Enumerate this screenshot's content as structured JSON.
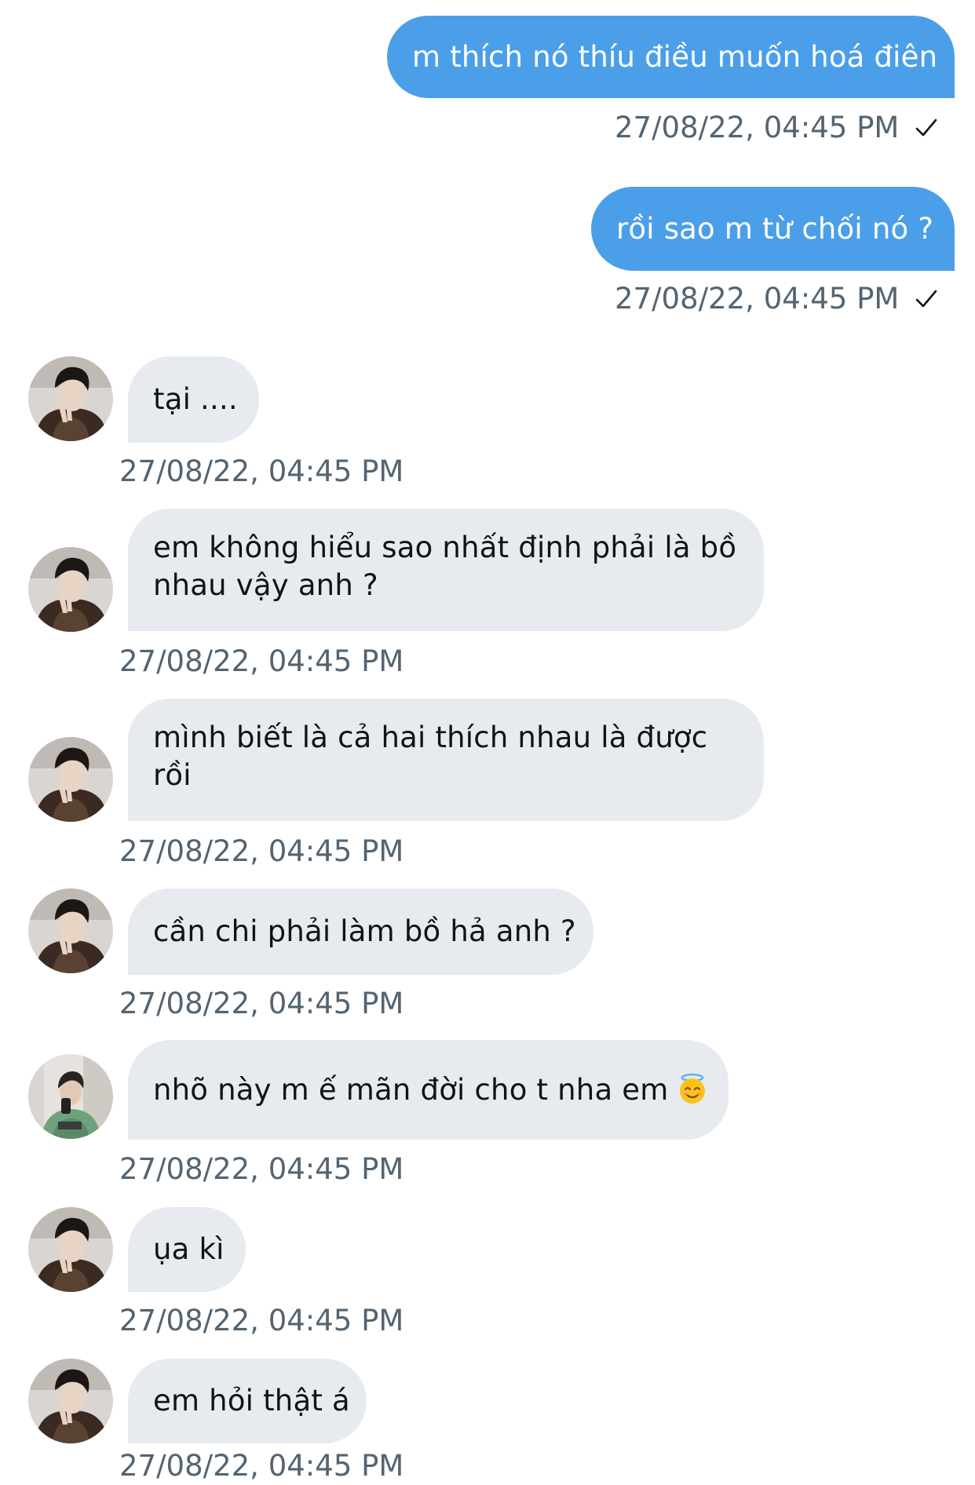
{
  "messages": [
    {
      "text": "m thích nó thíu điều muốn hoá điên",
      "time": "27/08/22, 04:45 PM"
    },
    {
      "text": "rồi sao m từ chối nó ?",
      "time": "27/08/22, 04:45 PM"
    },
    {
      "text": "tại ....",
      "time": "27/08/22, 04:45 PM"
    },
    {
      "text": "em không hiểu sao nhất định phải là bồ nhau vậy anh ?",
      "time": "27/08/22, 04:45 PM"
    },
    {
      "text": "mình biết là cả hai thích nhau là được rồi",
      "time": "27/08/22, 04:45 PM"
    },
    {
      "text": "cần chi phải làm bồ hả anh ?",
      "time": "27/08/22, 04:45 PM"
    },
    {
      "text": "nhõ này m ế mãn đời cho t nha em",
      "time": "27/08/22, 04:45 PM",
      "emoji": "smiling-face-with-halo"
    },
    {
      "text": "ụa kì",
      "time": "27/08/22, 04:45 PM"
    },
    {
      "text": "em hỏi thật á",
      "time": "27/08/22, 04:45 PM"
    }
  ],
  "colors": {
    "outgoing_bubble": "#4b9fe8",
    "incoming_bubble": "#e7eaee",
    "timestamp": "#536471",
    "incoming_text": "#0f1419"
  },
  "icons": {
    "read_receipt": "checkmark-icon",
    "emoji": "smiling-face-with-halo"
  }
}
